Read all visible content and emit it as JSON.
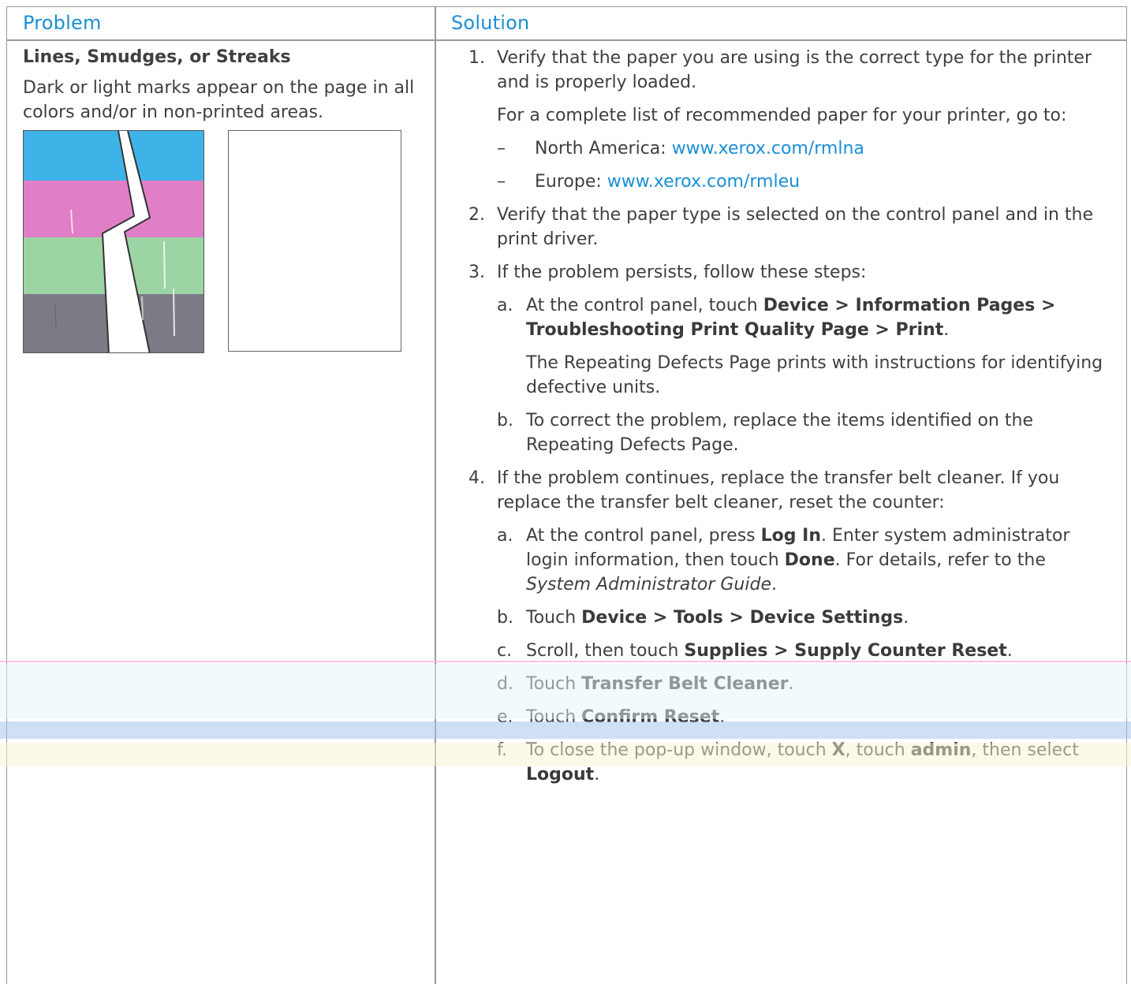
{
  "headers": {
    "problem": "Problem",
    "solution": "Solution"
  },
  "problem": {
    "title": "Lines, Smudges, or Streaks",
    "description": "Dark or light marks appear on the page in all colors and/or in non-printed areas."
  },
  "illustration": {
    "bands": [
      "#3fb3e8",
      "#e07fc8",
      "#9dd4a4",
      "#7b7b86"
    ]
  },
  "solution": {
    "step1": {
      "num": "1.",
      "text": "Verify that the paper you are using is the correct type for the printer and is properly loaded.",
      "para": "For a complete list of recommended paper for your printer, go to:",
      "links": [
        {
          "dash": "–",
          "label": "North America: ",
          "url": "www.xerox.com/rmlna"
        },
        {
          "dash": "–",
          "label": "Europe: ",
          "url": "www.xerox.com/rmleu"
        }
      ]
    },
    "step2": {
      "num": "2.",
      "text": "Verify that the paper type is selected on the control panel and in the print driver."
    },
    "step3": {
      "num": "3.",
      "text": "If the problem persists, follow these steps:",
      "a": {
        "num": "a.",
        "pre": "At the control panel, touch ",
        "device": "Device",
        "sep1": " > ",
        "info": "Information Pages",
        "sep2": " > ",
        "tpqp": "Troubleshooting Print Quality Page",
        "sep3": " > ",
        "print": "Print",
        "end": ".",
        "para": "The Repeating Defects Page prints with instructions for identifying defective units."
      },
      "b": {
        "num": "b.",
        "text": "To correct the problem, replace the items identified on the Repeating Defects Page."
      }
    },
    "step4": {
      "num": "4.",
      "text": "If the problem continues, replace the transfer belt cleaner. If you replace the transfer belt cleaner, reset the counter:",
      "a": {
        "num": "a.",
        "pre": "At the control panel, press ",
        "login": "Log In",
        "mid": ". Enter system administrator login information, then touch ",
        "done": "Done",
        "mid2": ". For details, refer to the ",
        "guide": "System Administrator Guide",
        "end": "."
      },
      "b": {
        "num": "b.",
        "pre": "Touch ",
        "device": "Device",
        "sep1": " > ",
        "tools": "Tools",
        "sep2": " > ",
        "settings": "Device Settings",
        "end": "."
      },
      "c": {
        "num": "c.",
        "pre": "Scroll, then touch ",
        "supplies": "Supplies",
        "sep": " > ",
        "reset": "Supply Counter Reset",
        "end": "."
      },
      "d": {
        "num": "d.",
        "pre": "Touch ",
        "cleaner": "Transfer Belt Cleaner",
        "end": "."
      },
      "e": {
        "num": "e.",
        "pre": "Touch ",
        "confirm": "Confirm Reset",
        "end": "."
      },
      "f": {
        "num": "f.",
        "pre": "To close the pop-up window, touch ",
        "x": "X",
        "mid": ", touch ",
        "admin": "admin",
        "mid2": ", then select ",
        "logout": "Logout",
        "end": "."
      }
    }
  }
}
